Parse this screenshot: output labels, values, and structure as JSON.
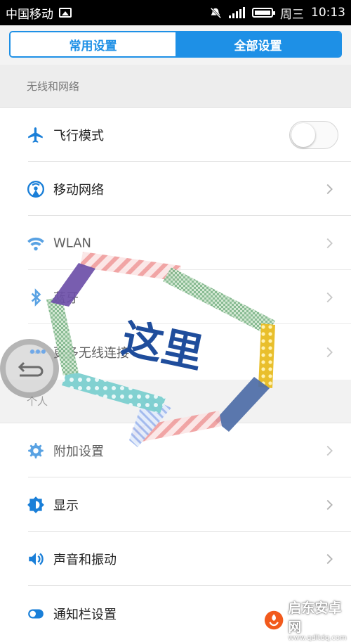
{
  "status_bar": {
    "carrier": "中国移动",
    "weekday": "周三",
    "time": "10:13"
  },
  "tabs": {
    "common": "常用设置",
    "all": "全部设置"
  },
  "sections": {
    "wireless": "无线和网络",
    "personal": "个人"
  },
  "items": {
    "airplane": {
      "label": "飞行模式",
      "toggle_on": false
    },
    "mobile_network": "移动网络",
    "wlan": "WLAN",
    "bluetooth": "蓝牙",
    "more_wireless": "更多无线连接",
    "additional": "附加设置",
    "display": "显示",
    "sound": "声音和振动",
    "notification": "通知栏设置"
  },
  "annotation": {
    "text": "这里"
  },
  "watermark": {
    "name": "启东安卓网",
    "url": "www.qdltdq.com"
  },
  "colors": {
    "accent": "#1e90e6",
    "icon_blue": "#1a7fd8",
    "header_bg": "#ededed"
  }
}
